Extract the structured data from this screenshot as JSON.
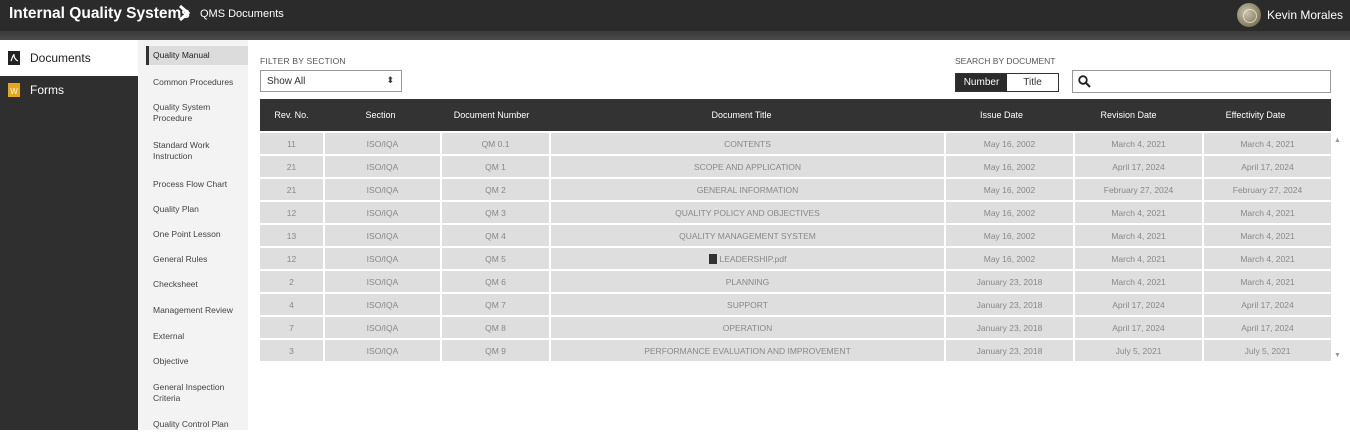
{
  "header": {
    "app_title": "Internal Quality Systems",
    "breadcrumb": "QMS Documents",
    "user_name": "Kevin Morales"
  },
  "sidebar": {
    "items": [
      {
        "label": "Documents",
        "icon": "pdf-icon",
        "active": true
      },
      {
        "label": "Forms",
        "icon": "word-icon",
        "active": false
      }
    ]
  },
  "subnav": {
    "items": [
      "Quality Manual",
      "Common Procedures",
      "Quality System Procedure",
      "Standard Work Instruction",
      "Process Flow Chart",
      "Quality Plan",
      "One Point Lesson",
      "General Rules",
      "Checksheet",
      "Management Review",
      "External",
      "Objective",
      "General Inspection Criteria",
      "Quality Control Plan"
    ]
  },
  "filter": {
    "label": "FILTER BY SECTION",
    "selected": "Show All"
  },
  "search": {
    "label": "SEARCH BY DOCUMENT",
    "mode_number": "Number",
    "mode_title": "Title",
    "active_mode": "Number",
    "value": ""
  },
  "table": {
    "columns": [
      "Rev. No.",
      "Section",
      "Document Number",
      "Document Title",
      "Issue Date",
      "Revision Date",
      "Effectivity Date"
    ],
    "rows": [
      [
        "11",
        "ISO/IQA",
        "QM 0.1",
        "CONTENTS",
        "May 16, 2002",
        "March 4, 2021",
        "March 4, 2021"
      ],
      [
        "21",
        "ISO/IQA",
        "QM 1",
        "SCOPE AND APPLICATION",
        "May 16, 2002",
        "April 17, 2024",
        "April 17, 2024"
      ],
      [
        "21",
        "ISO/IQA",
        "QM 2",
        "GENERAL INFORMATION",
        "May 16, 2002",
        "February 27, 2024",
        "February 27, 2024"
      ],
      [
        "12",
        "ISO/IQA",
        "QM 3",
        "QUALITY POLICY AND OBJECTIVES",
        "May 16, 2002",
        "March 4, 2021",
        "March 4, 2021"
      ],
      [
        "13",
        "ISO/IQA",
        "QM 4",
        "QUALITY MANAGEMENT SYSTEM",
        "May 16, 2002",
        "March 4, 2021",
        "March 4, 2021"
      ],
      [
        "12",
        "ISO/IQA",
        "QM 5",
        "LEADERSHIP.pdf",
        "May 16, 2002",
        "March 4, 2021",
        "March 4, 2021"
      ],
      [
        "2",
        "ISO/IQA",
        "QM 6",
        "PLANNING",
        "January 23, 2018",
        "March 4, 2021",
        "March 4, 2021"
      ],
      [
        "4",
        "ISO/IQA",
        "QM 7",
        "SUPPORT",
        "January 23, 2018",
        "April 17, 2024",
        "April 17, 2024"
      ],
      [
        "7",
        "ISO/IQA",
        "QM 8",
        "OPERATION",
        "January 23, 2018",
        "April 17, 2024",
        "April 17, 2024"
      ],
      [
        "3",
        "ISO/IQA",
        "QM 9",
        "PERFORMANCE EVALUATION AND IMPROVEMENT",
        "January 23, 2018",
        "July 5, 2021",
        "July 5, 2021"
      ]
    ],
    "pdf_row": 5
  }
}
